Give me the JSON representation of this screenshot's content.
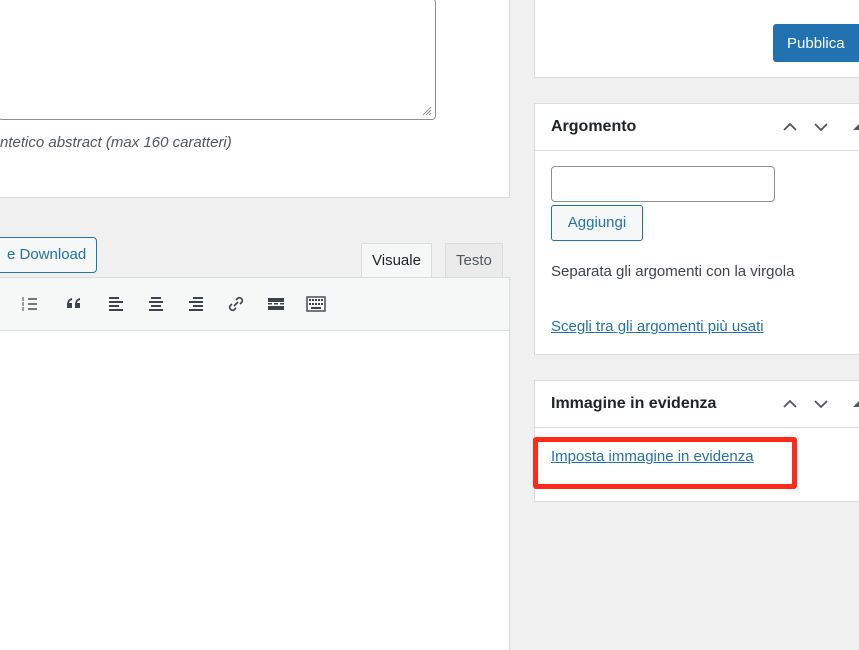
{
  "excerpt": {
    "hint": "ntetico abstract (max 160 caratteri)"
  },
  "editor": {
    "media_button_label": "e Download",
    "tabs": [
      {
        "label": "Visuale",
        "active": true
      },
      {
        "label": "Testo",
        "active": false
      }
    ],
    "toolbar_icons": [
      "numbered-list-icon",
      "blockquote-icon",
      "align-left-icon",
      "align-center-icon",
      "align-right-icon",
      "link-icon",
      "read-more-icon",
      "toolbar-toggle-icon"
    ]
  },
  "sidebar": {
    "publish": {
      "button_label": "Pubblica"
    },
    "topic": {
      "title": "Argomento",
      "input_value": "",
      "add_label": "Aggiungi",
      "help": "Separata gli argomenti con la virgola",
      "choose_link": "Scegli tra gli argomenti più usati"
    },
    "featured": {
      "title": "Immagine in evidenza",
      "set_link": "Imposta immagine in evidenza"
    }
  },
  "colors": {
    "accent": "#2271b1",
    "highlight": "#ff2a1a",
    "background": "#f0f0f1"
  }
}
